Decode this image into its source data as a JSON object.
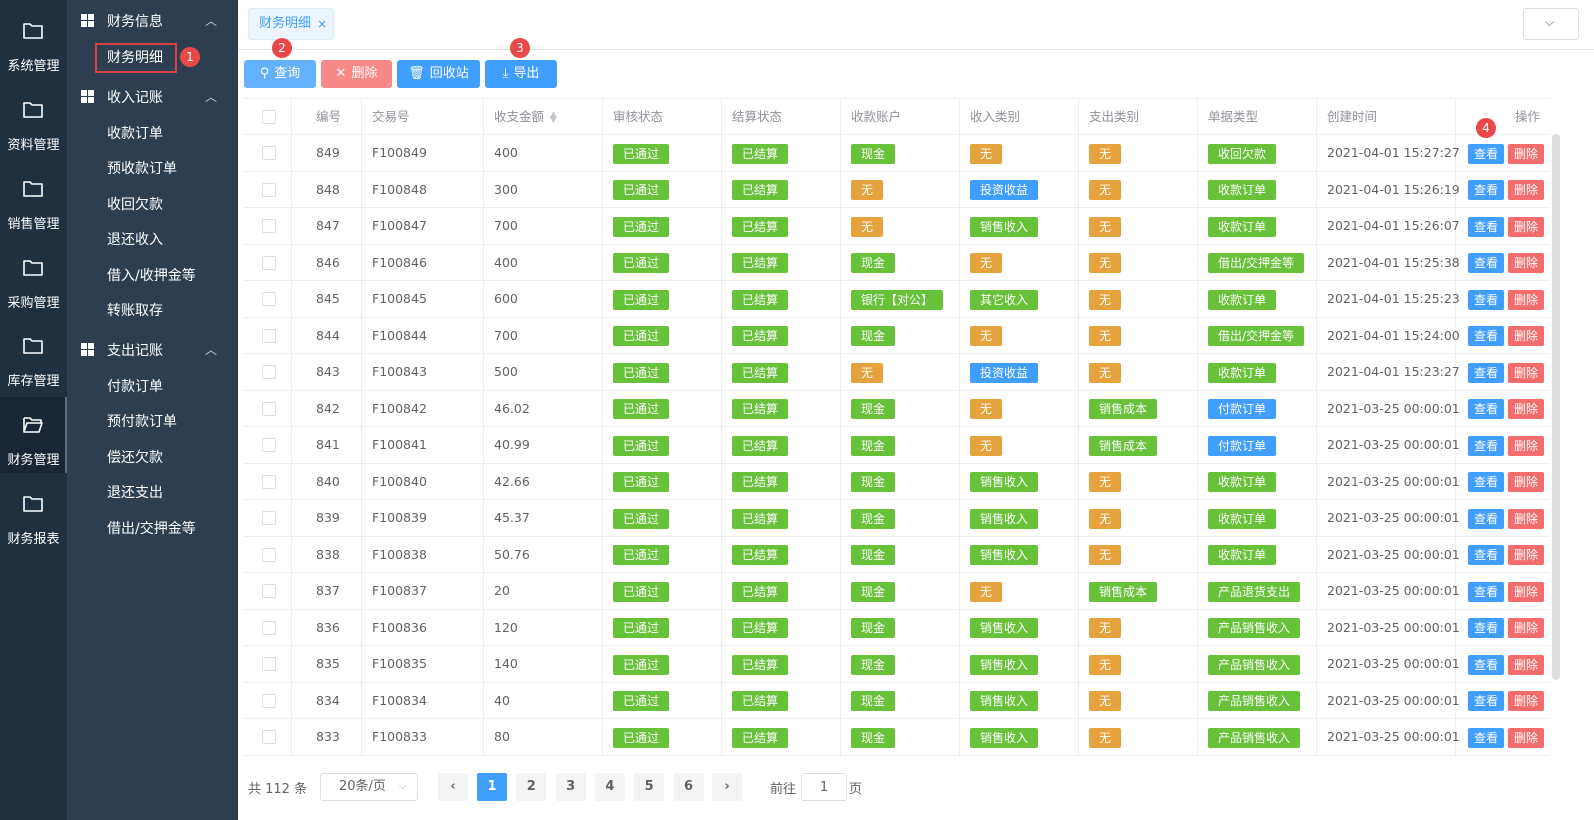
{
  "rail": [
    {
      "label": "系统管理",
      "icon": "folder-icon"
    },
    {
      "label": "资料管理",
      "icon": "folder-icon"
    },
    {
      "label": "销售管理",
      "icon": "folder-icon"
    },
    {
      "label": "采购管理",
      "icon": "folder-icon"
    },
    {
      "label": "库存管理",
      "icon": "folder-icon"
    },
    {
      "label": "财务管理",
      "icon": "folder-open-icon",
      "active": true
    },
    {
      "label": "财务报表",
      "icon": "folder-icon"
    }
  ],
  "submenu": {
    "groups": [
      {
        "title": "财务信息",
        "items": [
          "财务明细"
        ]
      },
      {
        "title": "收入记账",
        "items": [
          "收款订单",
          "预收款订单",
          "收回欠款",
          "退还收入",
          "借入/收押金等",
          "转账取存"
        ]
      },
      {
        "title": "支出记账",
        "items": [
          "付款订单",
          "预付款订单",
          "偿还欠款",
          "退还支出",
          "借出/交押金等"
        ]
      }
    ],
    "active_item": "财务明细"
  },
  "badges": [
    "1",
    "2",
    "3",
    "4"
  ],
  "tab": {
    "label": "财务明细",
    "close": "×"
  },
  "dropdown_icon": "chevron-down-icon",
  "toolbar": {
    "query": "查询",
    "delete": "删除",
    "recycle": "回收站",
    "export": "导出"
  },
  "colors": {
    "primary": "#409eff",
    "danger": "#f56c6c",
    "success": "#67c23a",
    "warning": "#e6a23c",
    "rail_bg": "#21303f",
    "submenu_bg": "#2c3e50"
  },
  "table": {
    "headers": [
      "编号",
      "交易号",
      "收支金额",
      "审核状态",
      "结算状态",
      "收款账户",
      "收入类别",
      "支出类别",
      "单据类型",
      "创建时间",
      "操作"
    ],
    "view_label": "查看",
    "delete_label": "删除",
    "rows": [
      {
        "id": "849",
        "trade": "F100849",
        "amount": "400",
        "audit": "已通过",
        "settle": "已结算",
        "account": "现金",
        "income": "无",
        "expense": "无",
        "doc": "收回欠款",
        "time": "2021-04-01 15:27:27"
      },
      {
        "id": "848",
        "trade": "F100848",
        "amount": "300",
        "audit": "已通过",
        "settle": "已结算",
        "account": "无",
        "income": "投资收益",
        "expense": "无",
        "doc": "收款订单",
        "time": "2021-04-01 15:26:19"
      },
      {
        "id": "847",
        "trade": "F100847",
        "amount": "700",
        "audit": "已通过",
        "settle": "已结算",
        "account": "无",
        "income": "销售收入",
        "expense": "无",
        "doc": "收款订单",
        "time": "2021-04-01 15:26:07"
      },
      {
        "id": "846",
        "trade": "F100846",
        "amount": "400",
        "audit": "已通过",
        "settle": "已结算",
        "account": "现金",
        "income": "无",
        "expense": "无",
        "doc": "借出/交押金等",
        "time": "2021-04-01 15:25:38"
      },
      {
        "id": "845",
        "trade": "F100845",
        "amount": "600",
        "audit": "已通过",
        "settle": "已结算",
        "account": "银行【对公】",
        "income": "其它收入",
        "expense": "无",
        "doc": "收款订单",
        "time": "2021-04-01 15:25:23"
      },
      {
        "id": "844",
        "trade": "F100844",
        "amount": "700",
        "audit": "已通过",
        "settle": "已结算",
        "account": "现金",
        "income": "无",
        "expense": "无",
        "doc": "借出/交押金等",
        "time": "2021-04-01 15:24:00"
      },
      {
        "id": "843",
        "trade": "F100843",
        "amount": "500",
        "audit": "已通过",
        "settle": "已结算",
        "account": "无",
        "income": "投资收益",
        "expense": "无",
        "doc": "收款订单",
        "time": "2021-04-01 15:23:27"
      },
      {
        "id": "842",
        "trade": "F100842",
        "amount": "46.02",
        "audit": "已通过",
        "settle": "已结算",
        "account": "现金",
        "income": "无",
        "expense": "销售成本",
        "doc": "付款订单",
        "time": "2021-03-25 00:00:01"
      },
      {
        "id": "841",
        "trade": "F100841",
        "amount": "40.99",
        "audit": "已通过",
        "settle": "已结算",
        "account": "现金",
        "income": "无",
        "expense": "销售成本",
        "doc": "付款订单",
        "time": "2021-03-25 00:00:01"
      },
      {
        "id": "840",
        "trade": "F100840",
        "amount": "42.66",
        "audit": "已通过",
        "settle": "已结算",
        "account": "现金",
        "income": "销售收入",
        "expense": "无",
        "doc": "收款订单",
        "time": "2021-03-25 00:00:01"
      },
      {
        "id": "839",
        "trade": "F100839",
        "amount": "45.37",
        "audit": "已通过",
        "settle": "已结算",
        "account": "现金",
        "income": "销售收入",
        "expense": "无",
        "doc": "收款订单",
        "time": "2021-03-25 00:00:01"
      },
      {
        "id": "838",
        "trade": "F100838",
        "amount": "50.76",
        "audit": "已通过",
        "settle": "已结算",
        "account": "现金",
        "income": "销售收入",
        "expense": "无",
        "doc": "收款订单",
        "time": "2021-03-25 00:00:01"
      },
      {
        "id": "837",
        "trade": "F100837",
        "amount": "20",
        "audit": "已通过",
        "settle": "已结算",
        "account": "现金",
        "income": "无",
        "expense": "销售成本",
        "doc": "产品退货支出",
        "time": "2021-03-25 00:00:01"
      },
      {
        "id": "836",
        "trade": "F100836",
        "amount": "120",
        "audit": "已通过",
        "settle": "已结算",
        "account": "现金",
        "income": "销售收入",
        "expense": "无",
        "doc": "产品销售收入",
        "time": "2021-03-25 00:00:01"
      },
      {
        "id": "835",
        "trade": "F100835",
        "amount": "140",
        "audit": "已通过",
        "settle": "已结算",
        "account": "现金",
        "income": "销售收入",
        "expense": "无",
        "doc": "产品销售收入",
        "time": "2021-03-25 00:00:01"
      },
      {
        "id": "834",
        "trade": "F100834",
        "amount": "40",
        "audit": "已通过",
        "settle": "已结算",
        "account": "现金",
        "income": "销售收入",
        "expense": "无",
        "doc": "产品销售收入",
        "time": "2021-03-25 00:00:01"
      },
      {
        "id": "833",
        "trade": "F100833",
        "amount": "80",
        "audit": "已通过",
        "settle": "已结算",
        "account": "现金",
        "income": "销售收入",
        "expense": "无",
        "doc": "产品销售收入",
        "time": "2021-03-25 00:00:01"
      }
    ]
  },
  "pagination": {
    "total": "共 112 条",
    "page_size": "20条/页",
    "pages": [
      "1",
      "2",
      "3",
      "4",
      "5",
      "6"
    ],
    "current": "1",
    "prev": "‹",
    "next": "›",
    "goto_prefix": "前往",
    "goto_value": "1",
    "goto_suffix": "页"
  }
}
